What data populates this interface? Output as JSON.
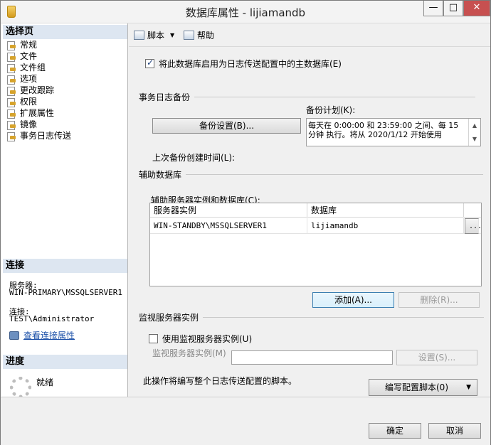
{
  "window": {
    "title": "数据库属性 - lijiamandb",
    "minimize": "—",
    "maximize": "□",
    "close": "✕"
  },
  "left": {
    "select_page_header": "选择页",
    "pages": [
      "常规",
      "文件",
      "文件组",
      "选项",
      "更改跟踪",
      "权限",
      "扩展属性",
      "镜像",
      "事务日志传送"
    ],
    "selected_page": "事务日志传送",
    "connection_header": "连接",
    "server_label": "服务器:",
    "server_value": "WIN-PRIMARY\\MSSQLSERVER1",
    "connection_label": "连接:",
    "connection_value": "TEST\\Administrator",
    "view_connection_link": "查看连接属性",
    "progress_header": "进度",
    "progress_status": "就绪"
  },
  "toolbar": {
    "script_label": "脚本",
    "help_label": "帮助"
  },
  "main": {
    "enable_primary_checkbox_label": "将此数据库启用为日志传送配置中的主数据库(E)",
    "enable_primary_checked": true,
    "tlog_backup_group": "事务日志备份",
    "backup_settings_button": "备份设置(B)...",
    "backup_schedule_label": "备份计划(K):",
    "backup_schedule_text": "每天在 0:00:00 和 23:59:00 之间、每 15 分钟 执行。将从 2020/1/12 开始使用",
    "last_backup_label": "上次备份创建时间(L):",
    "secondary_db_group": "辅助数据库",
    "secondary_instances_label": "辅助服务器实例和数据库(C):",
    "grid": {
      "columns": [
        "服务器实例",
        "数据库"
      ],
      "rows": [
        {
          "server": "WIN-STANDBY\\MSSQLSERVER1",
          "database": "lijiamandb",
          "action": "..."
        }
      ]
    },
    "add_button": "添加(A)...",
    "remove_button": "删除(R)...",
    "monitor_group": "监视服务器实例",
    "use_monitor_checkbox_label": "使用监视服务器实例(U)",
    "use_monitor_checked": false,
    "monitor_instance_label": "监视服务器实例(M)",
    "monitor_instance_value": "",
    "monitor_settings_button": "设置(S)...",
    "script_note": "此操作将编写整个日志传送配置的脚本。",
    "script_config_button": "编写配置脚本(0)"
  },
  "footer": {
    "ok_button": "确定",
    "cancel_button": "取消"
  }
}
